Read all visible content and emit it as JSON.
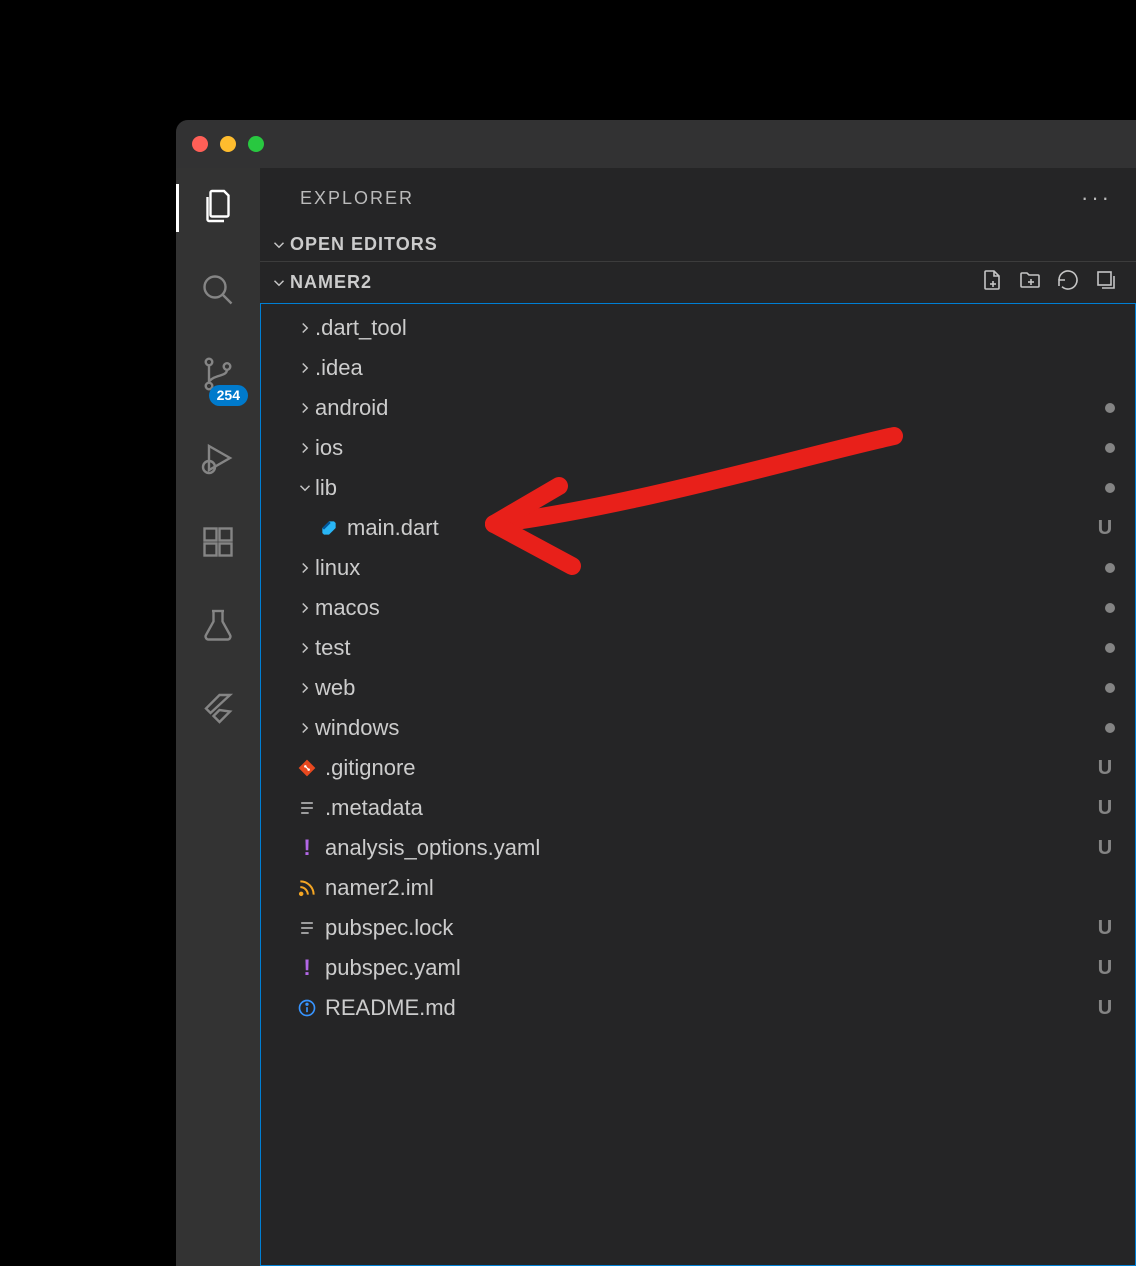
{
  "sidebar": {
    "title": "EXPLORER",
    "sections": {
      "openEditors": "OPEN EDITORS",
      "project": "NAMER2"
    },
    "badges": {
      "scm": "254"
    }
  },
  "tree": {
    "items": [
      {
        "name": ".dart_tool",
        "kind": "folder",
        "depth": 1,
        "open": false,
        "status": ""
      },
      {
        "name": ".idea",
        "kind": "folder",
        "depth": 1,
        "open": false,
        "status": ""
      },
      {
        "name": "android",
        "kind": "folder",
        "depth": 1,
        "open": false,
        "status": "dot"
      },
      {
        "name": "ios",
        "kind": "folder",
        "depth": 1,
        "open": false,
        "status": "dot"
      },
      {
        "name": "lib",
        "kind": "folder",
        "depth": 1,
        "open": true,
        "status": "dot"
      },
      {
        "name": "main.dart",
        "kind": "file-dart",
        "depth": 2,
        "status": "U"
      },
      {
        "name": "linux",
        "kind": "folder",
        "depth": 1,
        "open": false,
        "status": "dot"
      },
      {
        "name": "macos",
        "kind": "folder",
        "depth": 1,
        "open": false,
        "status": "dot"
      },
      {
        "name": "test",
        "kind": "folder",
        "depth": 1,
        "open": false,
        "status": "dot"
      },
      {
        "name": "web",
        "kind": "folder",
        "depth": 1,
        "open": false,
        "status": "dot"
      },
      {
        "name": "windows",
        "kind": "folder",
        "depth": 1,
        "open": false,
        "status": "dot"
      },
      {
        "name": ".gitignore",
        "kind": "file-git",
        "depth": 1,
        "status": "U"
      },
      {
        "name": ".metadata",
        "kind": "file-text",
        "depth": 1,
        "status": "U"
      },
      {
        "name": "analysis_options.yaml",
        "kind": "file-yaml",
        "depth": 1,
        "status": "U"
      },
      {
        "name": "namer2.iml",
        "kind": "file-rss",
        "depth": 1,
        "status": ""
      },
      {
        "name": "pubspec.lock",
        "kind": "file-text",
        "depth": 1,
        "status": "U"
      },
      {
        "name": "pubspec.yaml",
        "kind": "file-yaml",
        "depth": 1,
        "status": "U"
      },
      {
        "name": "README.md",
        "kind": "file-info",
        "depth": 1,
        "status": "U"
      }
    ]
  }
}
